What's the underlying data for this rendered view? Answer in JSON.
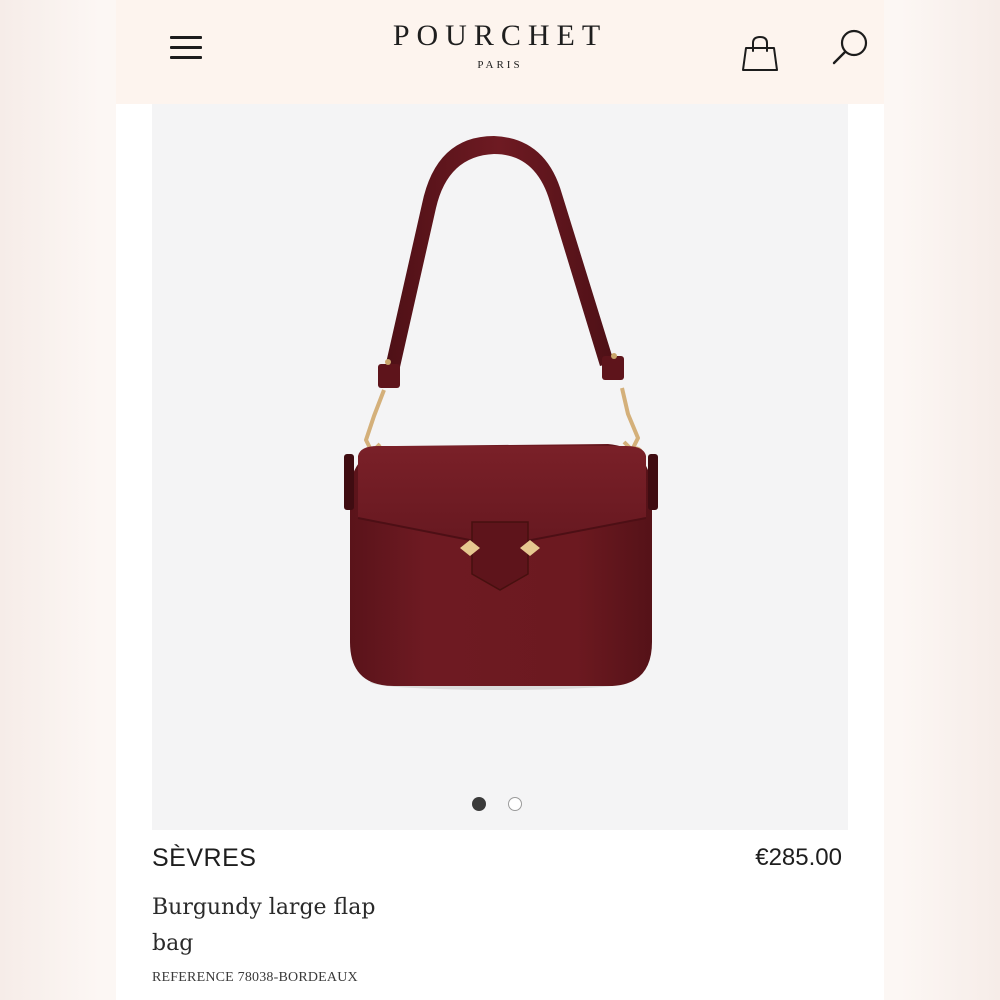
{
  "header": {
    "menu_icon": "hamburger-menu-icon",
    "brand_name": "POURCHET",
    "brand_sub": "PARIS",
    "cart_icon": "shopping-bag-icon",
    "search_icon": "search-icon"
  },
  "gallery": {
    "image_count": 2,
    "active_index": 0,
    "product_color": "#6e1a22",
    "hardware_color": "#d4b07a"
  },
  "product": {
    "name": "SÈVRES",
    "price": "€285.00",
    "description": "Burgundy large flap bag",
    "reference": "REFERENCE 78038-BORDEAUX"
  },
  "colors": {
    "header_bg": "#fdf4ee",
    "text": "#1e1e1e"
  }
}
